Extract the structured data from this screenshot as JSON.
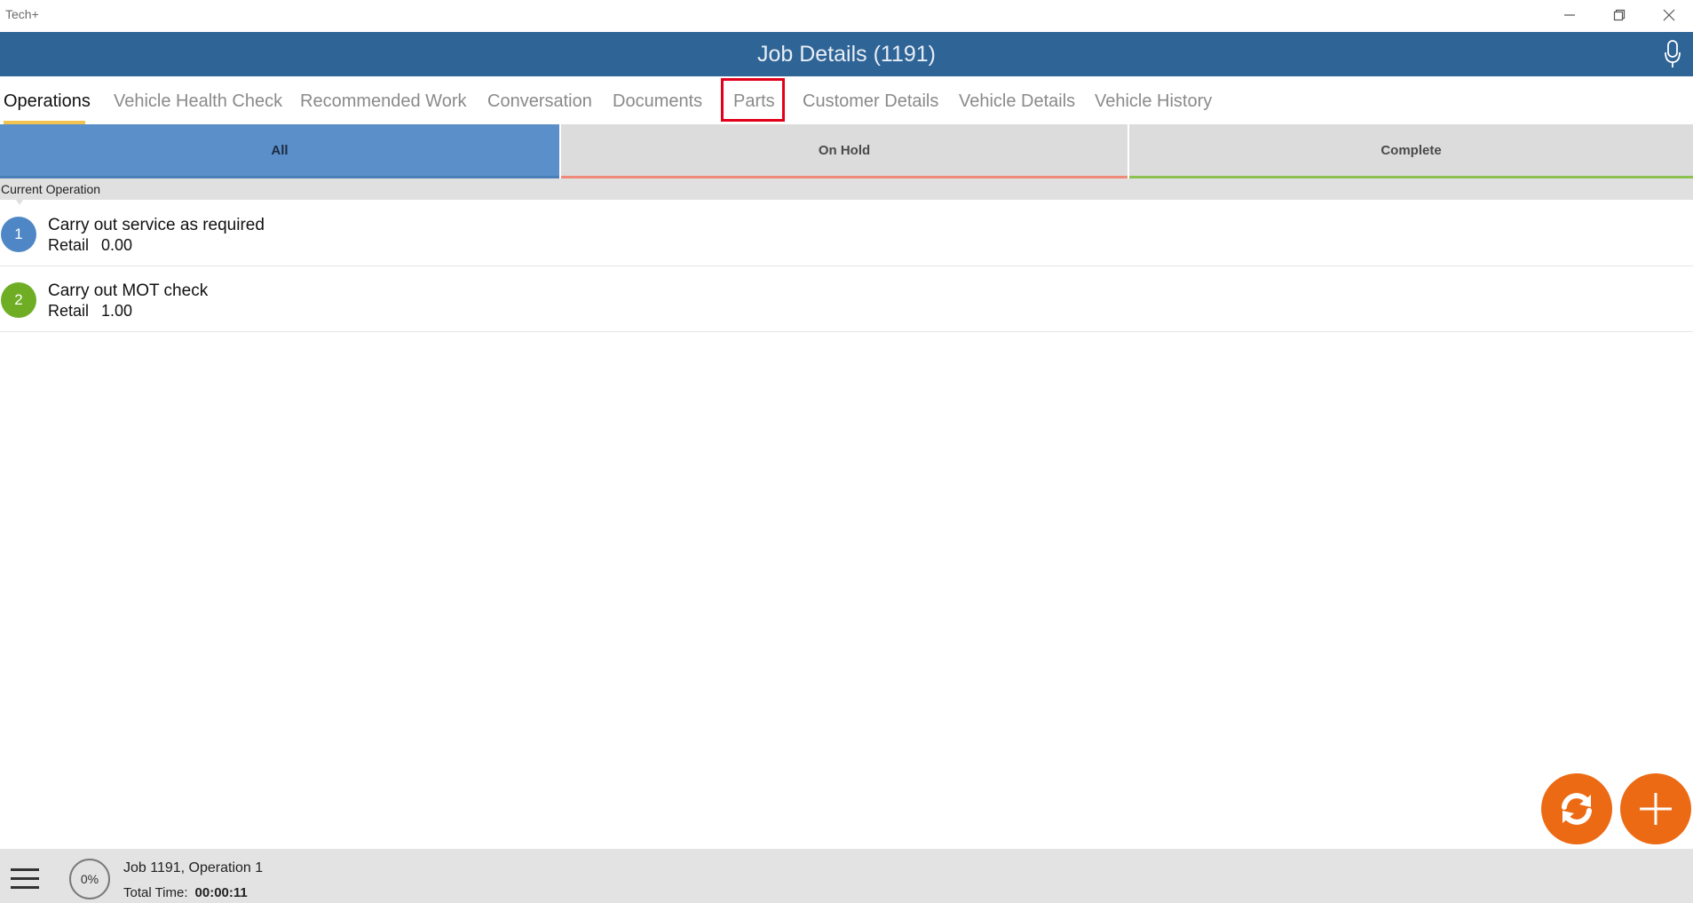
{
  "window": {
    "app_title": "Tech+"
  },
  "header": {
    "title": "Job Details (1191)"
  },
  "tabs": [
    {
      "label": "Operations",
      "active": true
    },
    {
      "label": "Vehicle Health Check",
      "active": false
    },
    {
      "label": "Recommended Work",
      "active": false
    },
    {
      "label": "Conversation",
      "active": false
    },
    {
      "label": "Documents",
      "active": false
    },
    {
      "label": "Parts",
      "active": false,
      "highlighted": true
    },
    {
      "label": "Customer Details",
      "active": false
    },
    {
      "label": "Vehicle Details",
      "active": false
    },
    {
      "label": "Vehicle History",
      "active": false
    }
  ],
  "filters": {
    "all": "All",
    "on_hold": "On Hold",
    "complete": "Complete"
  },
  "section": {
    "current_label": "Current Operation"
  },
  "operations": [
    {
      "number": "1",
      "title": "Carry out service as required",
      "type_label": "Retail",
      "value": "0.00",
      "badge_color": "#4f87c6"
    },
    {
      "number": "2",
      "title": "Carry out MOT check",
      "type_label": "Retail",
      "value": "1.00",
      "badge_color": "#6fae24"
    }
  ],
  "footer": {
    "progress": "0%",
    "job_line": "Job 1191, Operation 1",
    "total_time_label": "Total Time:",
    "total_time_value": "00:00:11"
  },
  "icons": {
    "minimize": "minimize-icon",
    "maximize": "restore-icon",
    "close": "close-icon",
    "mic": "microphone-icon",
    "sync": "sync-icon",
    "add": "plus-icon",
    "menu": "hamburger-menu-icon"
  },
  "colors": {
    "header_bg": "#2f6496",
    "accent_orange": "#ec6a13",
    "tab_underline": "#f2c34f",
    "filter_all": "#5b8fc9",
    "filter_on_hold": "#ef8a78",
    "filter_complete": "#8cc152",
    "highlight_box": "#e2001a"
  }
}
